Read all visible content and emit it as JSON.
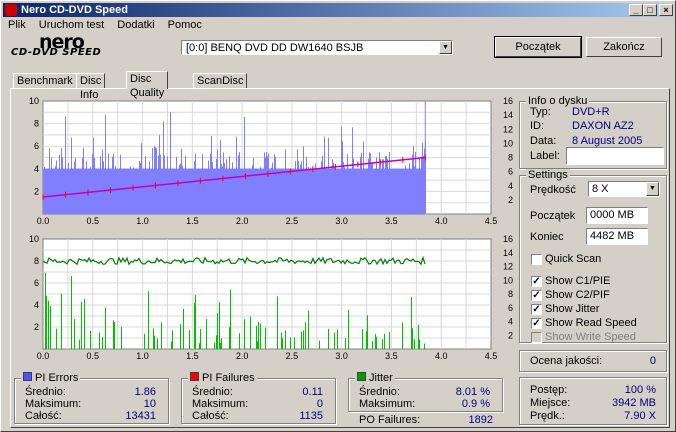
{
  "window": {
    "title": "Nero CD-DVD Speed",
    "btn_min": "_",
    "btn_max": "□",
    "btn_close": "×"
  },
  "menu": [
    "Plik",
    "Uruchom test",
    "Dodatki",
    "Pomoc"
  ],
  "logo": {
    "line1": "nero",
    "line2": "CD-DVD SPEED"
  },
  "drive": {
    "selected": "[0:0]  BENQ DVD DD DW1640 BSJB"
  },
  "buttons": {
    "start": "Początek",
    "end": "Zakończ"
  },
  "tabs": [
    "Benchmark",
    "Disc Info",
    "Disc Quality",
    "ScanDisc"
  ],
  "active_tab": "Disc Quality",
  "disc_info": {
    "title": "Info o dysku",
    "type_label": "Typ:",
    "type_value": "DVD+R",
    "id_label": "ID:",
    "id_value": "DAXON AZ2",
    "date_label": "Data:",
    "date_value": "8 August 2005",
    "label_label": "Label:",
    "label_value": ""
  },
  "settings": {
    "title": "Settings",
    "speed_label": "Prędkość",
    "speed_value": "8 X",
    "start_label": "Początek",
    "start_value": "0000 MB",
    "end_label": "Koniec",
    "end_value": "4482 MB",
    "checks": [
      {
        "label": "Quick Scan",
        "checked": false,
        "enabled": true
      },
      {
        "label": "Show C1/PIE",
        "checked": true,
        "enabled": true
      },
      {
        "label": "Show C2/PIF",
        "checked": true,
        "enabled": true
      },
      {
        "label": "Show Jitter",
        "checked": true,
        "enabled": true
      },
      {
        "label": "Show Read Speed",
        "checked": true,
        "enabled": true
      },
      {
        "label": "Show Write Speed",
        "checked": false,
        "enabled": false
      }
    ]
  },
  "quality": {
    "label": "Ocena jakości:",
    "value": "0"
  },
  "progress": {
    "postep_label": "Postęp:",
    "postep_value": "100 %",
    "miejsce_label": "Miejsce:",
    "miejsce_value": "3942 MB",
    "predk_label": "Prędk.:",
    "predk_value": "7.90 X"
  },
  "pi_errors": {
    "title": "PI Errors",
    "color": "#5050ff",
    "avg_label": "Średnio:",
    "avg": "1.86",
    "max_label": "Maksimum:",
    "max": "10",
    "total_label": "Całość:",
    "total": "13431"
  },
  "pi_failures": {
    "title": "PI Failures",
    "color": "#ff0000",
    "avg_label": "Średnio:",
    "avg": "0.11",
    "max_label": "Maksimum:",
    "max": "0",
    "total_label": "Całość:",
    "total": "1135"
  },
  "jitter": {
    "title": "Jitter",
    "color": "#00a000",
    "avg_label": "Średnio:",
    "avg": "8.01 %",
    "max_label": "Maksimum:",
    "max": "0.9 %"
  },
  "po_failures": {
    "label": "PO Failures:",
    "value": "1892"
  },
  "chart_data": [
    {
      "type": "bar",
      "title": "",
      "x_ticks": [
        "0.0",
        "0.5",
        "1.0",
        "1.5",
        "2.0",
        "2.5",
        "3.0",
        "3.5",
        "4.0",
        "4.5"
      ],
      "y_left_ticks": [
        "2",
        "4",
        "6",
        "8",
        "10"
      ],
      "y_right_ticks": [
        "2",
        "4",
        "6",
        "8",
        "10",
        "12",
        "14",
        "16"
      ],
      "xlim": [
        0,
        4.5
      ],
      "ylim_left": [
        0,
        10
      ],
      "ylim_right": [
        0,
        16
      ],
      "grid": true,
      "series": [
        {
          "name": "PI Errors",
          "color": "#8080ff",
          "baseline": 4,
          "peak": 10,
          "x_end": 3.84
        },
        {
          "name": "Read Speed",
          "color": "#c000c0",
          "x": [
            0.0,
            3.84
          ],
          "y": [
            2.4,
            8.0
          ]
        }
      ]
    },
    {
      "type": "bar",
      "title": "",
      "x_ticks": [
        "0.0",
        "0.5",
        "1.0",
        "1.5",
        "2.0",
        "2.5",
        "3.0",
        "3.5",
        "4.0",
        "4.5"
      ],
      "y_left_ticks": [
        "2",
        "4",
        "6",
        "8",
        "10"
      ],
      "y_right_ticks": [
        "2",
        "4",
        "6",
        "8",
        "10",
        "12",
        "14",
        "16"
      ],
      "xlim": [
        0,
        4.5
      ],
      "ylim_left": [
        0,
        10
      ],
      "ylim_right": [
        0,
        16
      ],
      "grid": true,
      "series": [
        {
          "name": "PI Failures",
          "color": "#00c000",
          "max": 7,
          "x_end": 3.84
        },
        {
          "name": "Jitter",
          "color": "#008000",
          "level": 8.0,
          "x_end": 3.84
        }
      ]
    }
  ]
}
